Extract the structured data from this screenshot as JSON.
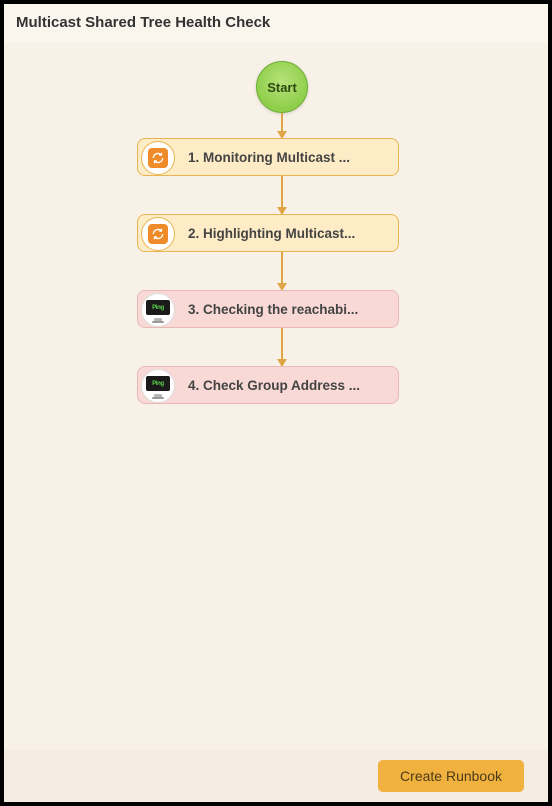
{
  "title": "Multicast Shared Tree Health Check",
  "start_label": "Start",
  "steps": [
    {
      "label": "1. Monitoring Multicast ...",
      "type": "orange",
      "icon": "refresh"
    },
    {
      "label": "2. Highlighting Multicast...",
      "type": "orange",
      "icon": "refresh"
    },
    {
      "label": "3. Checking the reachabi...",
      "type": "pink",
      "icon": "ping"
    },
    {
      "label": "4. Check Group Address ...",
      "type": "pink",
      "icon": "ping"
    }
  ],
  "ping_text": "Ping",
  "create_button": "Create Runbook"
}
